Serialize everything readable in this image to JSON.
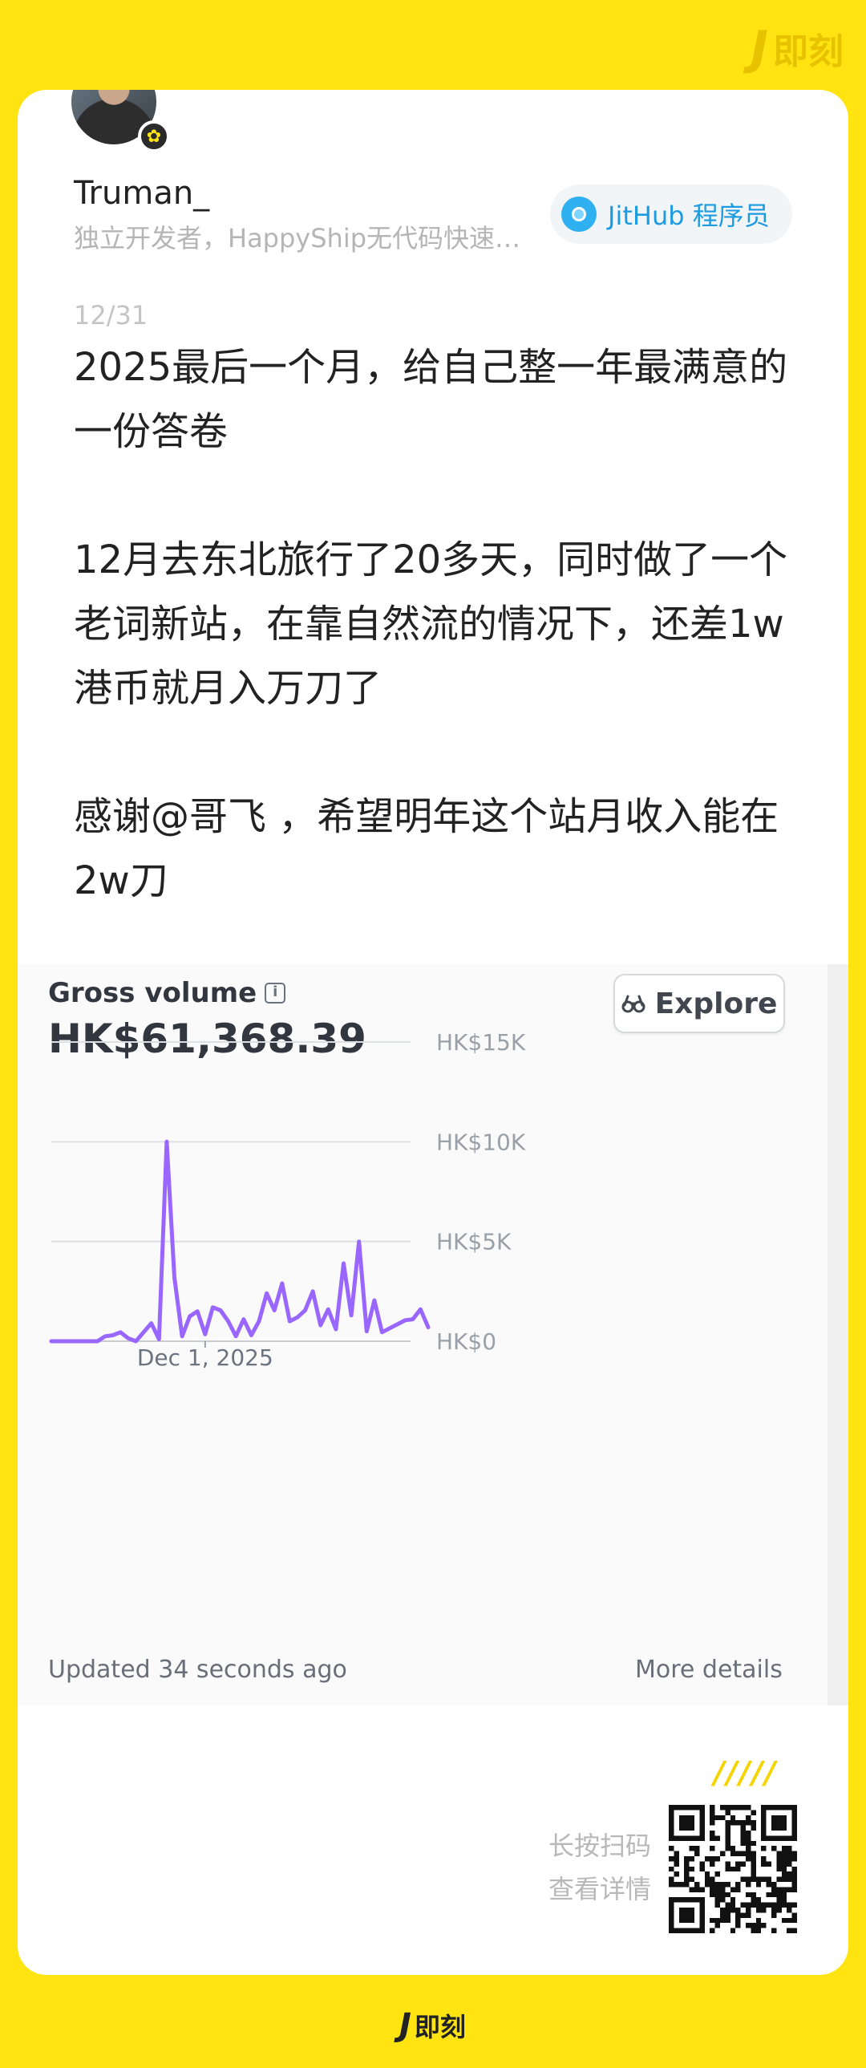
{
  "brand": {
    "name": "即刻",
    "mark": "J"
  },
  "author": {
    "username": "Truman_",
    "bio": "独立开发者，HappyShip无代码快速出海特训营主理人",
    "topic": "JitHub 程序员"
  },
  "post": {
    "date": "12/31",
    "paragraphs": [
      "2025最后一个月，给自己整一年最满意的一份答卷",
      "12月去东北旅行了20多天，同时做了一个老词新站，在靠自然流的情况下，还差1w港币就月入万刀了",
      "感谢@哥飞 ，希望明年这个站月收入能在2w刀"
    ]
  },
  "dashboard": {
    "title": "Gross volume",
    "value": "HK$61,368.39",
    "explore": "Explore",
    "updated": "Updated 34 seconds ago",
    "more": "More details"
  },
  "chart_data": {
    "type": "line",
    "color": "#9966FF",
    "grid": true,
    "y_ticks": [
      "HK$15K",
      "HK$10K",
      "HK$5K",
      "HK$0"
    ],
    "ylim": [
      0,
      15000
    ],
    "x_tick_label": "Dec 1, 2025",
    "x_tick_index": 20,
    "values": [
      0,
      0,
      0,
      0,
      0,
      0,
      0,
      250,
      300,
      450,
      150,
      0,
      450,
      900,
      100,
      10000,
      3200,
      250,
      1250,
      1500,
      350,
      1700,
      1550,
      1000,
      250,
      1100,
      300,
      1000,
      2400,
      1550,
      2900,
      1000,
      1200,
      1550,
      2500,
      800,
      1600,
      600,
      3900,
      1300,
      5000,
      500,
      2050,
      450,
      650,
      850,
      1050,
      1100,
      1600,
      700
    ]
  },
  "footer": {
    "slashes": "/////",
    "scan_line1": "长按扫码",
    "scan_line2": "查看详情"
  }
}
